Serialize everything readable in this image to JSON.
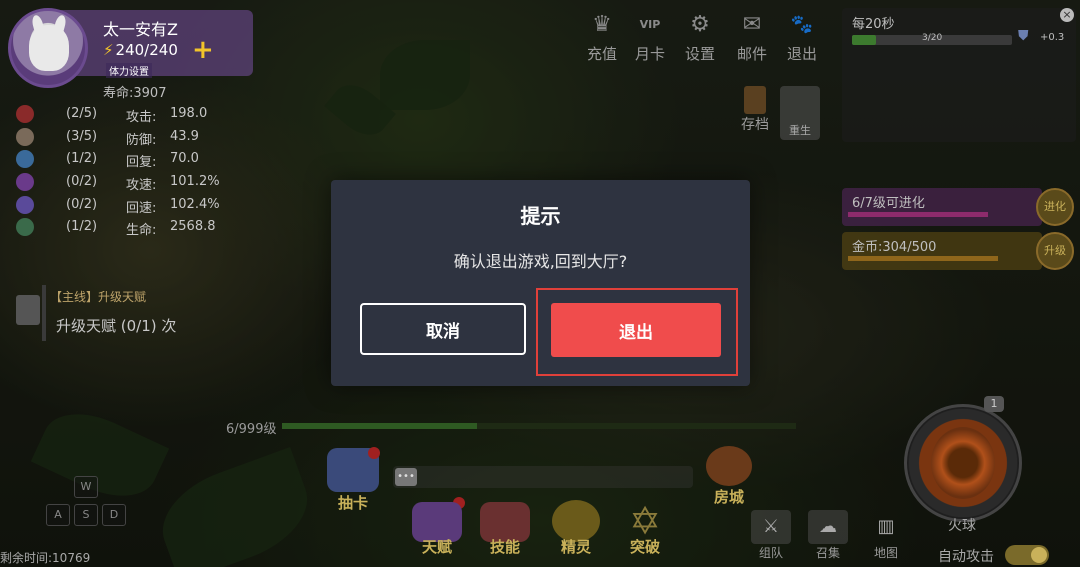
{
  "player": {
    "name": "太一安有Z",
    "stamina": "240/240",
    "stamina_setting": "体力设置",
    "life": "寿命:3907"
  },
  "stats": [
    {
      "icon": "fire-element-icon",
      "frac": "(2/5)",
      "label": "攻击:",
      "value": "198.0",
      "color": "#8a2a2a"
    },
    {
      "icon": "earth-element-icon",
      "frac": "(3/5)",
      "label": "防御:",
      "value": "43.9",
      "color": "#7a6a5a"
    },
    {
      "icon": "water-element-icon",
      "frac": "(1/2)",
      "label": "回复:",
      "value": "70.0",
      "color": "#3a6a9a"
    },
    {
      "icon": "lightning-element-icon",
      "frac": "(0/2)",
      "label": "攻速:",
      "value": "101.2%",
      "color": "#6a3a8a"
    },
    {
      "icon": "wind-element-icon",
      "frac": "(0/2)",
      "label": "回速:",
      "value": "102.4%",
      "color": "#5a4a9a"
    },
    {
      "icon": "nature-element-icon",
      "frac": "(1/2)",
      "label": "生命:",
      "value": "2568.8",
      "color": "#3a6a4a"
    }
  ],
  "quest": {
    "title": "【主线】升级天赋",
    "text": "升级天赋 (0/1) 次"
  },
  "top_menu": [
    {
      "label": "充值",
      "icon": "crown-icon",
      "glyph": "♛"
    },
    {
      "label": "月卡",
      "icon": "vip-card-icon",
      "glyph": "VIP"
    },
    {
      "label": "设置",
      "icon": "gear-icon",
      "glyph": "⚙"
    },
    {
      "label": "邮件",
      "icon": "mail-icon",
      "glyph": "✉"
    },
    {
      "label": "退出",
      "icon": "paw-icon",
      "glyph": "🐾"
    }
  ],
  "side": {
    "save": "存档",
    "reborn": "重生"
  },
  "top_right": {
    "title": "每20秒",
    "progress": 0.15,
    "count": "3/20",
    "bonus": "+0.3"
  },
  "evolve": {
    "label": "6/7级可进化",
    "badge": "进化"
  },
  "gold": {
    "label": "金币:304/500",
    "badge": "升级"
  },
  "level": {
    "label": "6/999级",
    "progress": 0.38
  },
  "bottom": {
    "draw": "抽卡",
    "talent": "天赋",
    "skill": "技能",
    "spirit": "精灵",
    "break": "突破",
    "home": "房城",
    "team": "组队",
    "summon": "召集",
    "map": "地图",
    "keys": [
      "W",
      "A",
      "S",
      "D"
    ],
    "remaining": "剩余时间:10769"
  },
  "skill_panel": {
    "name": "火球",
    "badge": "1",
    "auto_label": "自动攻击"
  },
  "dialog": {
    "title": "提示",
    "message": "确认退出游戏,回到大厅?",
    "cancel": "取消",
    "confirm": "退出"
  },
  "colors": {
    "confirm": "#f04c4c",
    "dialog_bg": "#2e3340",
    "highlight": "#e0403a"
  }
}
